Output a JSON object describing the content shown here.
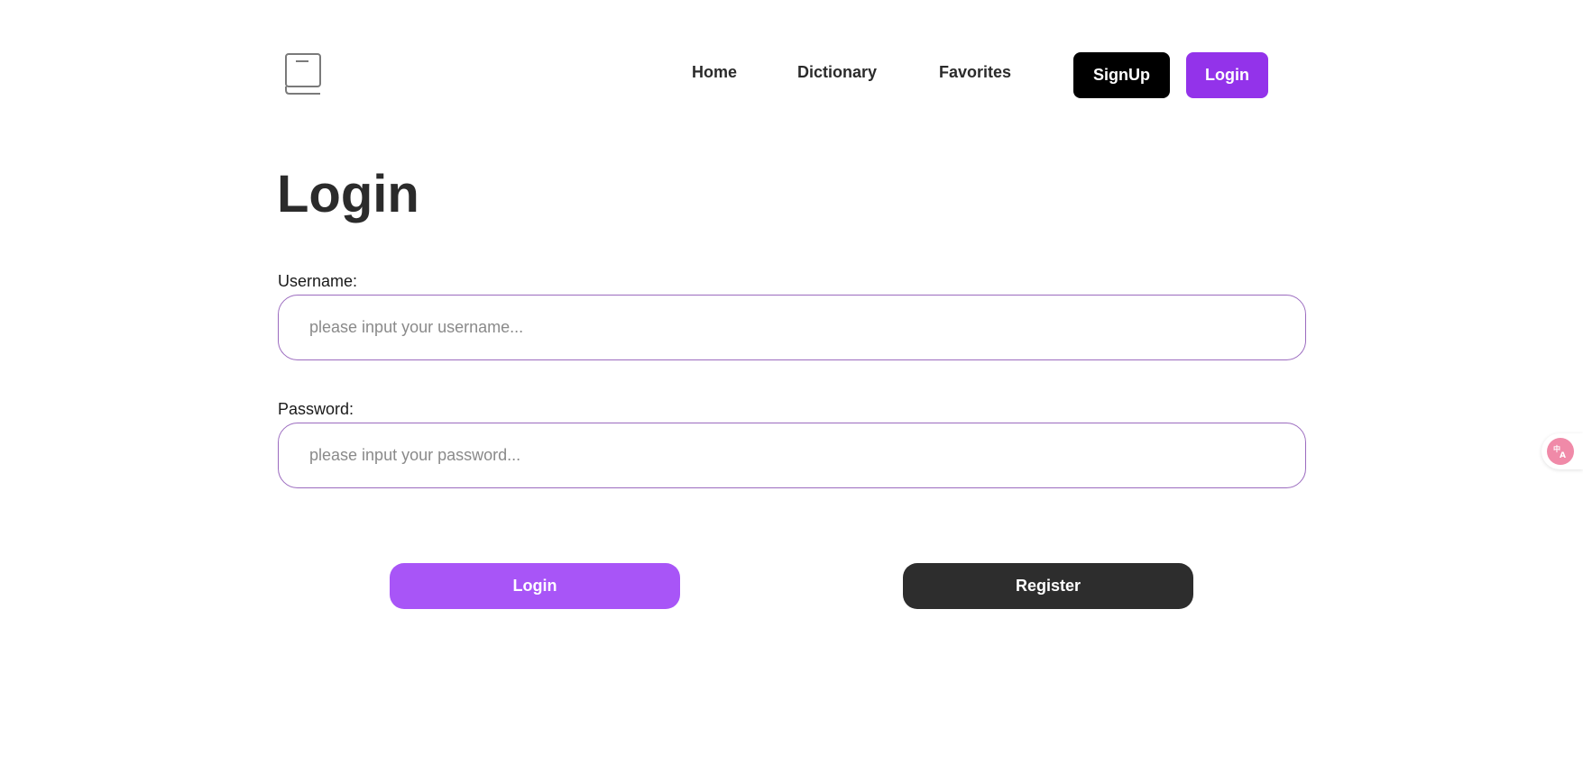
{
  "header": {
    "logo_icon": "book-icon",
    "nav": {
      "home": "Home",
      "dictionary": "Dictionary",
      "favorites": "Favorites"
    },
    "signup_label": "SignUp",
    "login_label": "Login"
  },
  "main": {
    "title": "Login",
    "username": {
      "label": "Username:",
      "placeholder": "please input your username...",
      "value": ""
    },
    "password": {
      "label": "Password:",
      "placeholder": "please input your password...",
      "value": ""
    },
    "login_button": "Login",
    "register_button": "Register"
  },
  "widgets": {
    "translate_icon": "translate-icon"
  },
  "colors": {
    "accent_purple": "#9333ea",
    "button_purple": "#a855f7",
    "register_dark": "#2d2d2d",
    "signup_black": "#000000",
    "input_border": "#9b6bbf",
    "translate_pink": "#f08aa8"
  }
}
